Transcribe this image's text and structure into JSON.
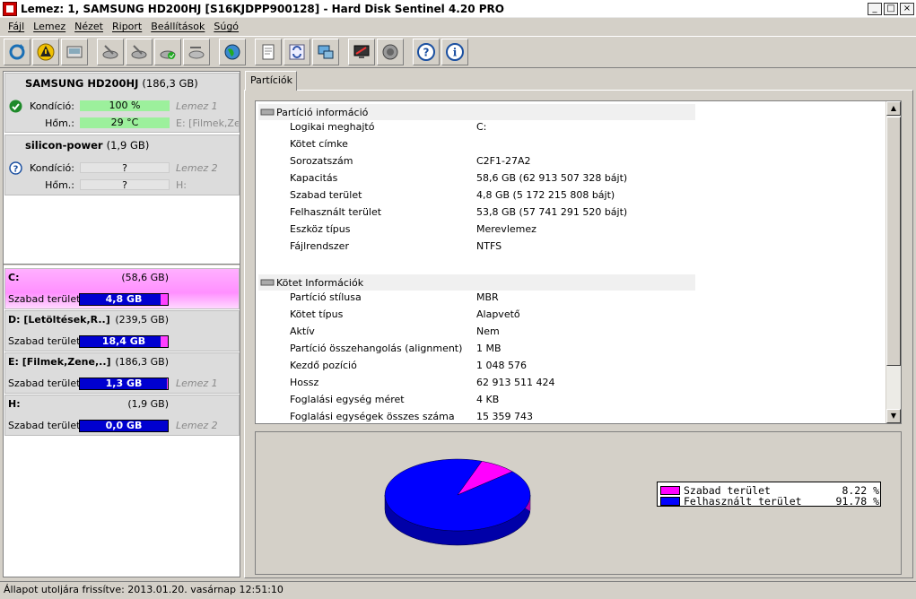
{
  "window": {
    "title": "Lemez: 1, SAMSUNG HD200HJ [S16KJDPP900128]  -  Hard Disk Sentinel 4.20 PRO"
  },
  "menu": [
    "Fájl",
    "Lemez",
    "Nézet",
    "Riport",
    "Beállítások",
    "Súgó"
  ],
  "toolbar": {
    "buttons": [
      "refresh-icon",
      "warning-icon",
      "disk-icon",
      "disk-tools-icon",
      "disk-tools-icon",
      "disk-check-icon",
      "disk-tools-icon",
      "globe-icon",
      "report-icon",
      "sync-icon",
      "network-icon",
      "monitor-icon",
      "sound-icon",
      "help-icon",
      "info-icon"
    ]
  },
  "disks": [
    {
      "name": "SAMSUNG HD200HJ",
      "size": "(186,3 GB)",
      "condition_label": "Kondíció:",
      "condition_value": "100 %",
      "temp_label": "Hőm.:",
      "temp_value": "29 °C",
      "note1": "Lemez 1",
      "note2": "E: [Filmek,Zene,..]",
      "status": "ok"
    },
    {
      "name": "silicon-power",
      "size": "(1,9 GB)",
      "condition_label": "Kondíció:",
      "condition_value": "?",
      "temp_label": "Hőm.:",
      "temp_value": "?",
      "note1": "Lemez 2",
      "note2": "H:",
      "status": "unknown"
    }
  ],
  "partitions": [
    {
      "name": "C:",
      "size": "(58,6 GB)",
      "free_label": "Szabad terület",
      "free": "4,8 GB",
      "free_fraction": 0.082,
      "note": "",
      "selected": true
    },
    {
      "name": "D: [Letöltések,R..]",
      "size": "(239,5 GB)",
      "free_label": "Szabad terület",
      "free": "18,4 GB",
      "free_fraction": 0.077,
      "note": "",
      "selected": false
    },
    {
      "name": "E: [Filmek,Zene,..]",
      "size": "(186,3 GB)",
      "free_label": "Szabad terület",
      "free": "1,3 GB",
      "free_fraction": 0.007,
      "note": "Lemez 1",
      "selected": false
    },
    {
      "name": "H:",
      "size": "(1,9 GB)",
      "free_label": "Szabad terület",
      "free": "0,0 GB",
      "free_fraction": 0.0,
      "note": "Lemez 2",
      "selected": false
    }
  ],
  "tab": {
    "label": "Partíciók"
  },
  "sections": [
    {
      "title": "Partíció információ",
      "rows": [
        {
          "k": "Logikai meghajtó",
          "v": "C:"
        },
        {
          "k": "Kötet címke",
          "v": ""
        },
        {
          "k": "Sorozatszám",
          "v": "C2F1-27A2"
        },
        {
          "k": "Kapacitás",
          "v": "58,6 GB (62 913 507 328 bájt)"
        },
        {
          "k": "Szabad terület",
          "v": "4,8 GB (5 172 215 808 bájt)"
        },
        {
          "k": "Felhasznált terület",
          "v": "53,8 GB (57 741 291 520 bájt)"
        },
        {
          "k": "Eszköz típus",
          "v": "Merevlemez"
        },
        {
          "k": "Fájlrendszer",
          "v": "NTFS"
        }
      ]
    },
    {
      "title": "Kötet Információk",
      "rows": [
        {
          "k": "Partíció stílusa",
          "v": "MBR"
        },
        {
          "k": "Kötet típus",
          "v": "Alapvető"
        },
        {
          "k": "Aktív",
          "v": "Nem"
        },
        {
          "k": "Partíció összehangolás (alignment)",
          "v": "1 MB"
        },
        {
          "k": "Kezdő pozíció",
          "v": "1 048 576"
        },
        {
          "k": "Hossz",
          "v": "62 913 511 424"
        },
        {
          "k": "Foglalási egység méret",
          "v": "4 KB"
        },
        {
          "k": "Foglalási egységek összes száma",
          "v": "15 359 743"
        }
      ]
    }
  ],
  "chart_data": {
    "type": "pie",
    "categories": [
      "Szabad terület",
      "Felhasznált terület"
    ],
    "values": [
      8.22,
      91.78
    ],
    "legend_text": [
      "8.22 %",
      "91.78 %"
    ],
    "colors": [
      "#ff00ff",
      "#0000ff"
    ],
    "legend": "right"
  },
  "statusbar": {
    "text": "Állapot utoljára frissítve: 2013.01.20. vasárnap 12:51:10"
  }
}
